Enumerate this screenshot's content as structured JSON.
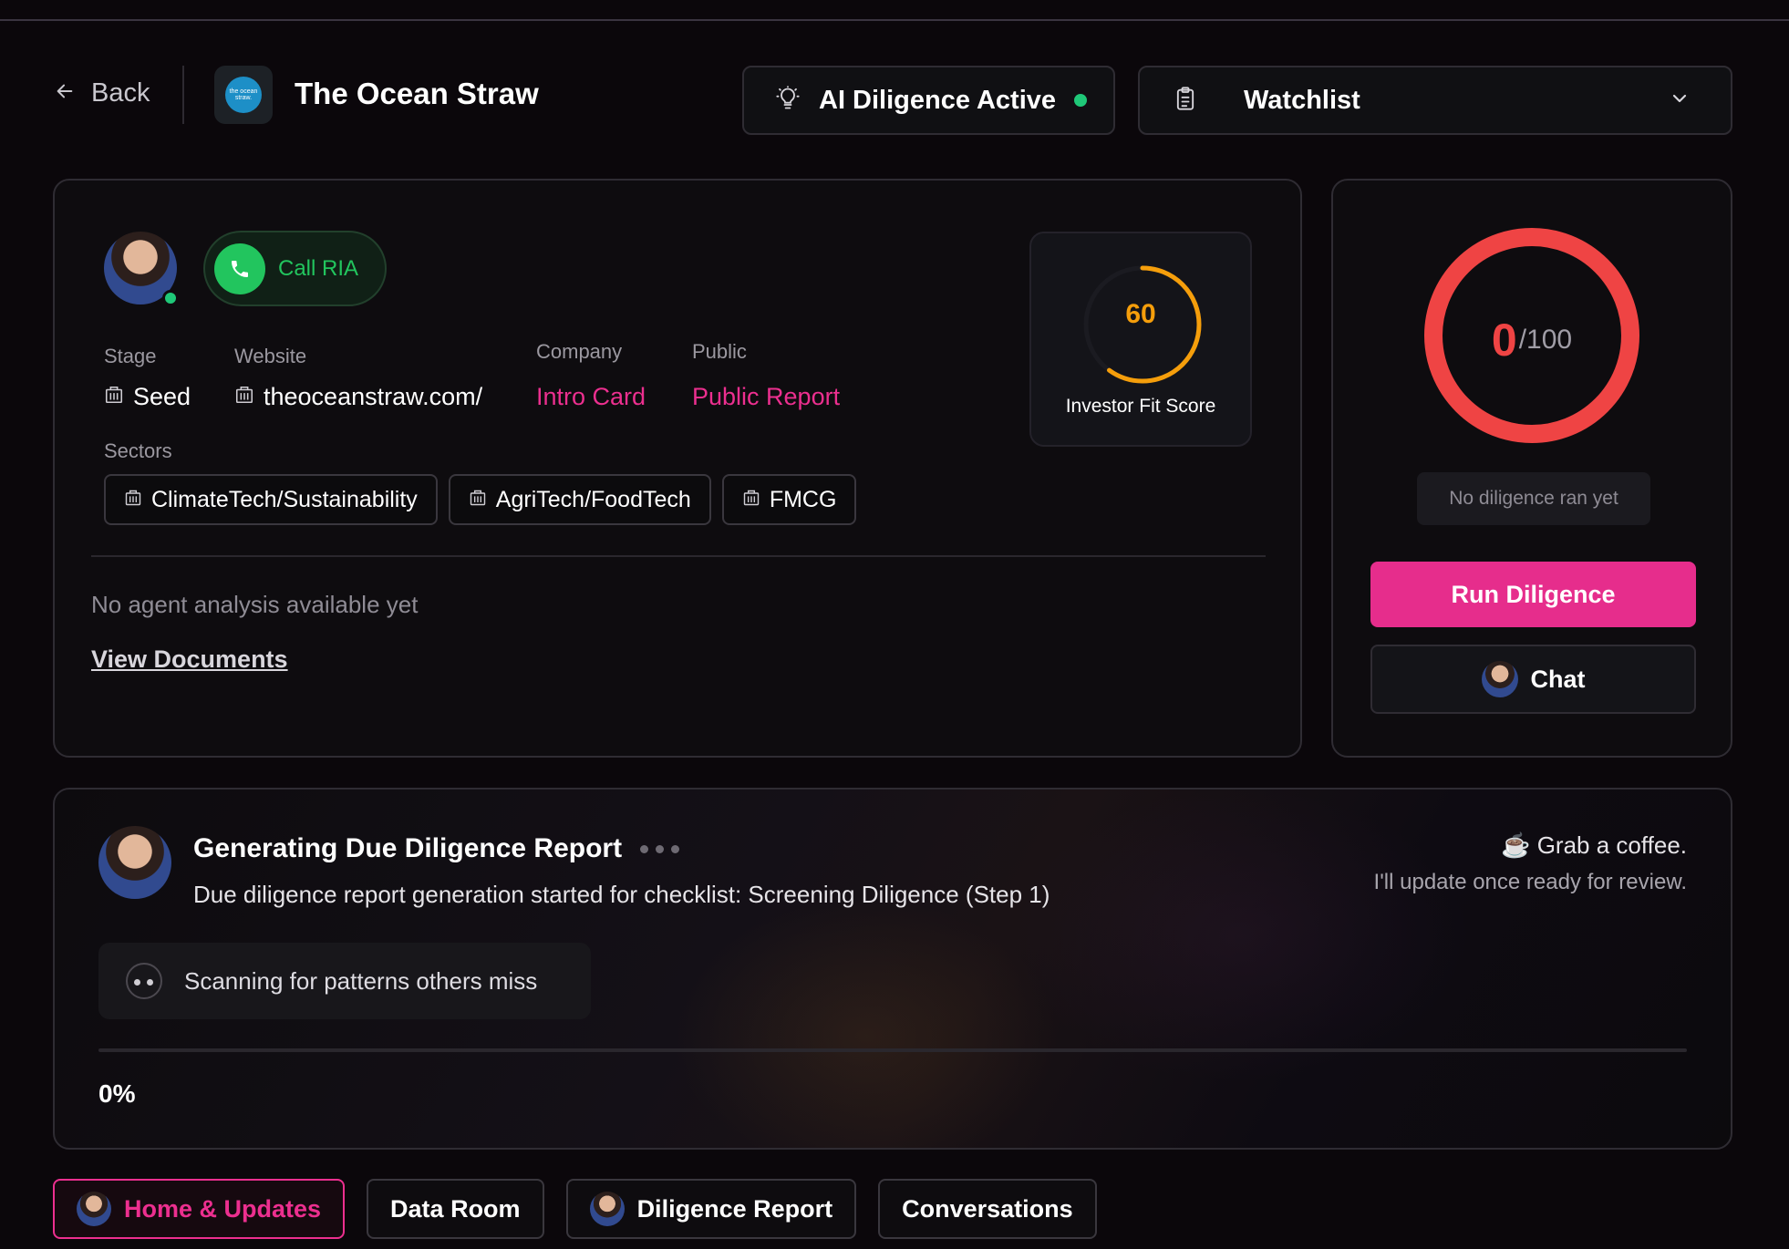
{
  "header": {
    "back_label": "Back",
    "logo_text": "the ocean straw.",
    "company_name": "The Ocean Straw",
    "ai_status_label": "AI Diligence Active",
    "watchlist_label": "Watchlist"
  },
  "profile": {
    "call_label": "Call RIA",
    "stage_label": "Stage",
    "stage_value": "Seed",
    "website_label": "Website",
    "website_value": "theoceanstraw.com/",
    "company_label": "Company",
    "company_link": "Intro Card",
    "public_label": "Public",
    "public_link": "Public Report",
    "sectors_label": "Sectors",
    "sectors": [
      "ClimateTech/Sustainability",
      "AgriTech/FoodTech",
      "FMCG"
    ],
    "no_analysis": "No agent analysis available yet",
    "view_documents": "View Documents"
  },
  "investor_fit": {
    "score": "60",
    "score_fraction": 0.6,
    "label": "Investor Fit Score"
  },
  "diligence": {
    "score": "0",
    "max": "/100",
    "status": "No diligence ran yet",
    "run_label": "Run Diligence",
    "chat_label": "Chat"
  },
  "progress": {
    "title": "Generating Due Diligence Report",
    "subtitle": "Due diligence report generation started for checklist: Screening Diligence (Step 1)",
    "coffee": "☕ Grab a coffee.",
    "update_note": "I'll update once ready for review.",
    "scan_text": "Scanning for patterns others miss",
    "percent_label": "0%",
    "percent": 0
  },
  "tabs": [
    {
      "label": "Home & Updates",
      "active": true
    },
    {
      "label": "Data Room",
      "active": false
    },
    {
      "label": "Diligence Report",
      "active": false
    },
    {
      "label": "Conversations",
      "active": false
    }
  ],
  "colors": {
    "accent_pink": "#e62d8c",
    "online_green": "#1fc878",
    "call_green": "#22c55e",
    "fit_orange": "#f59e0b",
    "ring_red": "#ef4444"
  }
}
